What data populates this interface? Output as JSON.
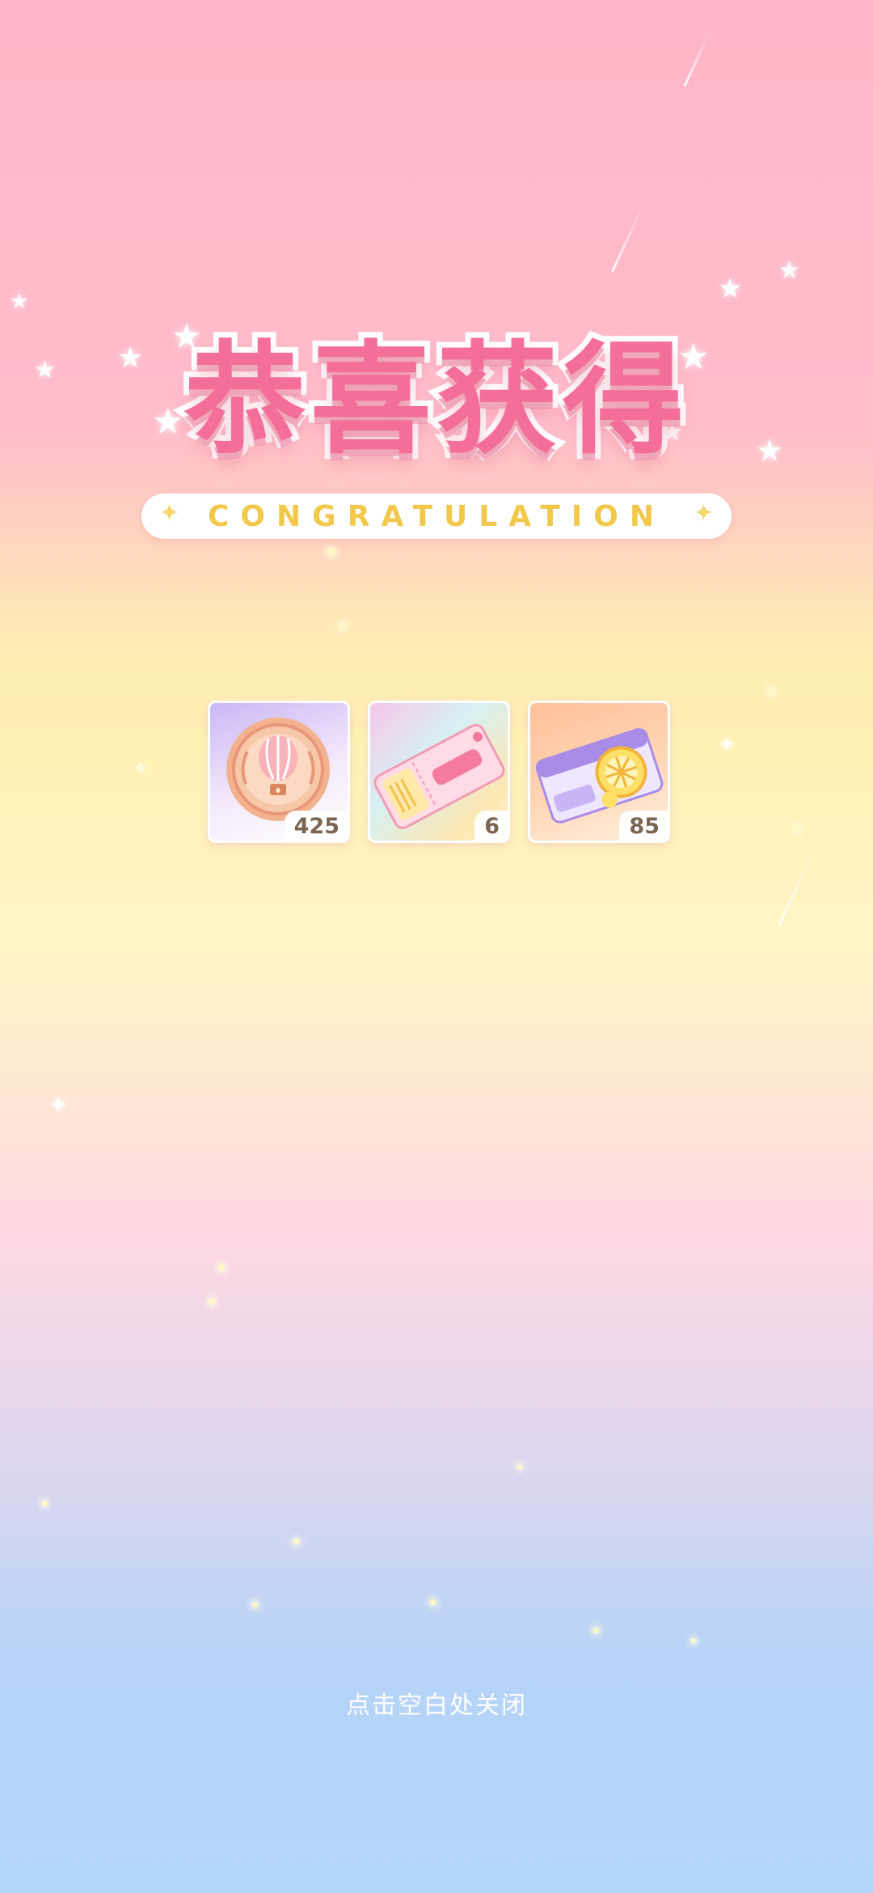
{
  "popup": {
    "title": "恭喜获得",
    "subtitle": "CONGRATULATION",
    "close_hint": "点击空白处关闭"
  },
  "rewards": [
    {
      "icon": "hot-air-balloon-medal-icon",
      "count": "425"
    },
    {
      "icon": "ticket-icon",
      "count": "6"
    },
    {
      "icon": "lucky-wheel-ticket-icon",
      "count": "85"
    }
  ],
  "colors": {
    "title": "#f36f9a",
    "subtitle": "#f2c84b",
    "background_top": "#ffb6c8",
    "background_bottom": "#b2d6fa"
  }
}
